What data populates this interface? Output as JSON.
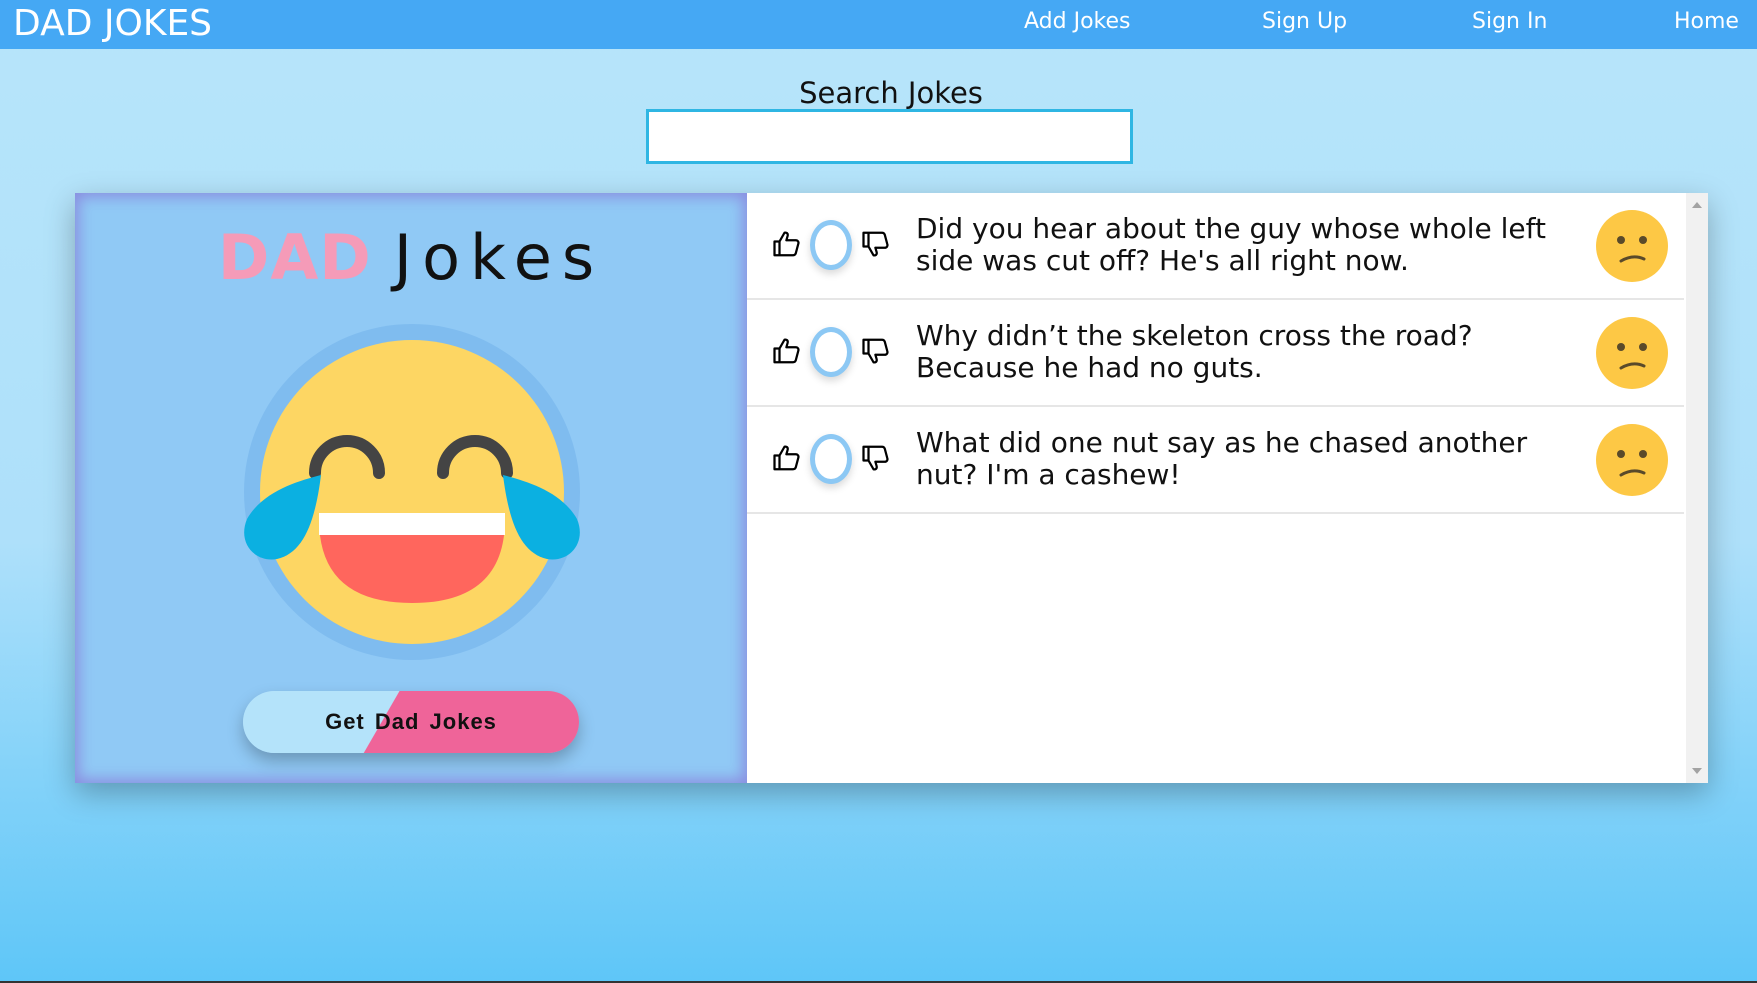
{
  "navbar": {
    "brand": "DAD JOKES",
    "links": {
      "add_jokes": "Add Jokes",
      "sign_up": "Sign Up",
      "sign_in": "Sign In",
      "home": "Home"
    },
    "color": "#45a8f4"
  },
  "search": {
    "label": "Search Jokes",
    "value": "",
    "placeholder": ""
  },
  "left_panel": {
    "title_bold": "DAD",
    "title_light": "Jokes",
    "emoji_icon": "face-with-tears-of-joy-icon",
    "button_label": "Get Dad Jokes"
  },
  "jokes": [
    {
      "text": "Did you hear about the guy whose whole left side was cut off? He's all right now.",
      "face_icon": "confused-face-icon"
    },
    {
      "text": "Why didn’t the skeleton cross the road? Because he had no guts.",
      "face_icon": "confused-face-icon"
    },
    {
      "text": "What did one nut say as he chased another nut? I'm a cashew!",
      "face_icon": "confused-face-icon"
    }
  ],
  "colors": {
    "accent_pink": "#ef6499",
    "panel_blue": "#90c9f5",
    "emoji_yellow": "#fdd663"
  }
}
